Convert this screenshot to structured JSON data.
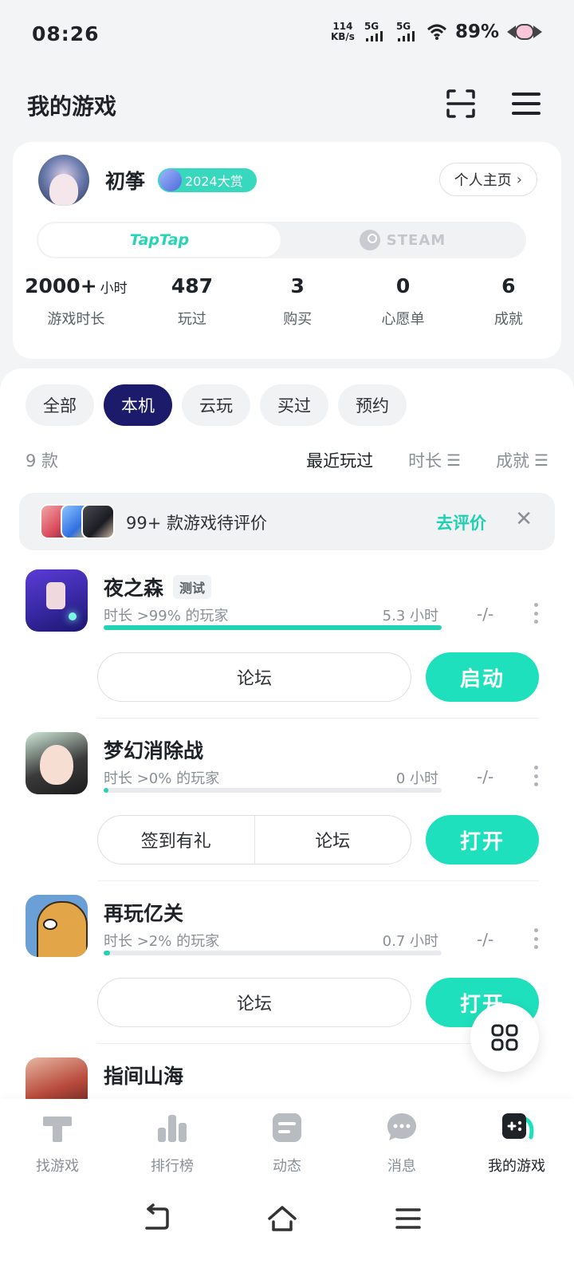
{
  "status_bar": {
    "time": "08:26",
    "net_speed": "114",
    "net_unit": "KB/s",
    "sim1": "5G",
    "sim2": "5G",
    "battery": "89%"
  },
  "header": {
    "title": "我的游戏",
    "icons": [
      "scan-icon",
      "menu-icon"
    ]
  },
  "profile": {
    "name": "初筝",
    "badge": "2024大赏",
    "profile_link": "个人主页",
    "platforms": {
      "active": "TapTap",
      "inactive": "STEAM"
    },
    "stats": [
      {
        "value": "2000+",
        "unit": "小时",
        "label": "游戏时长"
      },
      {
        "value": "487",
        "unit": "",
        "label": "玩过"
      },
      {
        "value": "3",
        "unit": "",
        "label": "购买"
      },
      {
        "value": "0",
        "unit": "",
        "label": "心愿单"
      },
      {
        "value": "6",
        "unit": "",
        "label": "成就"
      }
    ]
  },
  "filters": {
    "tabs": [
      "全部",
      "本机",
      "云玩",
      "买过",
      "预约"
    ],
    "active": "本机"
  },
  "sort": {
    "count": "9 款",
    "options": [
      "最近玩过",
      "时长",
      "成就"
    ],
    "active": "最近玩过"
  },
  "review_banner": {
    "text": "99+ 款游戏待评价",
    "action": "去评价"
  },
  "games": [
    {
      "title": "夜之森",
      "tag": "测试",
      "percentile": "时长 >99% 的玩家",
      "hours": "5.3 小时",
      "progress": 1.0,
      "score": "-/-",
      "buttons": [
        "论坛"
      ],
      "primary": "启动"
    },
    {
      "title": "梦幻消除战",
      "tag": "",
      "percentile": "时长 >0% 的玩家",
      "hours": "0 小时",
      "progress": 0.01,
      "score": "-/-",
      "buttons": [
        "签到有礼",
        "论坛"
      ],
      "primary": "打开"
    },
    {
      "title": "再玩亿关",
      "tag": "",
      "percentile": "时长 >2% 的玩家",
      "hours": "0.7 小时",
      "progress": 0.02,
      "score": "-/-",
      "buttons": [
        "论坛"
      ],
      "primary": "打开"
    },
    {
      "title": "指间山海",
      "tag": ""
    }
  ],
  "bottom_nav": {
    "items": [
      "找游戏",
      "排行榜",
      "动态",
      "消息",
      "我的游戏"
    ],
    "active": "我的游戏"
  },
  "colors": {
    "accent": "#1fe0bd",
    "active_tab": "#1c1a6b"
  }
}
